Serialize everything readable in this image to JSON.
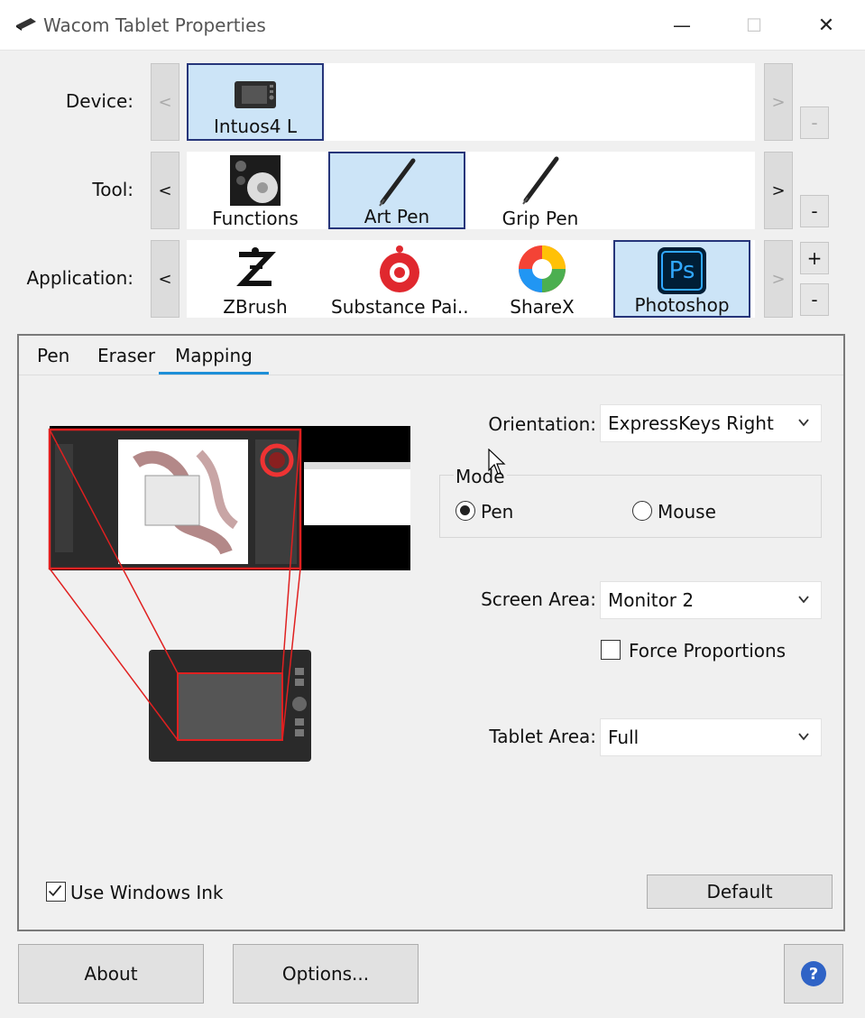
{
  "window": {
    "title": "Wacom Tablet Properties",
    "minimize": "—",
    "maximize": "☐",
    "close": "✕"
  },
  "device_row": {
    "label": "Device:",
    "prev": "<",
    "next": ">",
    "side_button": "-",
    "items": [
      {
        "label": "Intuos4 L",
        "icon": "tablet-icon",
        "selected": true
      }
    ]
  },
  "tool_row": {
    "label": "Tool:",
    "prev": "<",
    "next": ">",
    "side_button": "-",
    "items": [
      {
        "label": "Functions",
        "icon": "functions-icon",
        "selected": false
      },
      {
        "label": "Art Pen",
        "icon": "pen-icon",
        "selected": true
      },
      {
        "label": "Grip Pen",
        "icon": "pen-icon",
        "selected": false
      }
    ]
  },
  "application_row": {
    "label": "Application:",
    "prev": "<",
    "next": ">",
    "add_button": "+",
    "remove_button": "-",
    "items": [
      {
        "label": "ZBrush",
        "icon": "zbrush-icon",
        "selected": false
      },
      {
        "label": "Substance Pai...",
        "icon": "substance-painter-icon",
        "selected": false
      },
      {
        "label": "ShareX",
        "icon": "sharex-icon",
        "selected": false
      },
      {
        "label": "Photoshop",
        "icon": "photoshop-icon",
        "selected": true,
        "icon_text": "Ps"
      }
    ]
  },
  "tabs": [
    {
      "label": "Pen",
      "active": false
    },
    {
      "label": "Eraser",
      "active": false
    },
    {
      "label": "Mapping",
      "active": true
    }
  ],
  "mapping": {
    "orientation": {
      "label": "Orientation:",
      "value": "ExpressKeys Right"
    },
    "mode": {
      "title": "Mode",
      "options": [
        {
          "label": "Pen",
          "selected": true
        },
        {
          "label": "Mouse",
          "selected": false
        }
      ]
    },
    "screen_area": {
      "label": "Screen Area:",
      "value": "Monitor 2"
    },
    "force_proportions": {
      "label": "Force Proportions",
      "checked": false
    },
    "tablet_area": {
      "label": "Tablet Area:",
      "value": "Full"
    },
    "use_windows_ink": {
      "label": "Use Windows Ink",
      "checked": true
    },
    "default_button": "Default"
  },
  "footer": {
    "about": "About",
    "options": "Options...",
    "help_icon": "help-icon",
    "help_text": "?"
  },
  "colors": {
    "selection_bg": "#cce4f7",
    "selection_border": "#26357a",
    "tab_accent": "#1e8fd8",
    "mapping_outline": "#e02020",
    "help_blue": "#2f63c6"
  }
}
